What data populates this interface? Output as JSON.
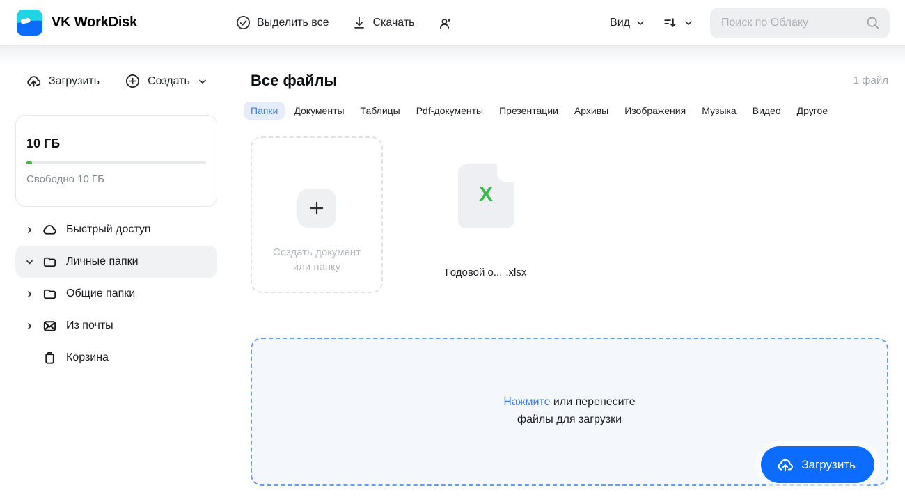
{
  "header": {
    "app_title": "VK WorkDisk",
    "actions": {
      "select_all": "Выделить все",
      "download": "Скачать"
    },
    "view": {
      "label": "Вид"
    },
    "search": {
      "placeholder": "Поиск по Облаку"
    }
  },
  "sidebar": {
    "upload_label": "Загрузить",
    "create_label": "Создать",
    "storage": {
      "total": "10 ГБ",
      "free_label": "Свободно 10 ГБ",
      "used_percent": 2
    },
    "items": [
      {
        "label": "Быстрый доступ",
        "icon": "cloud-icon",
        "chevron": "right",
        "selected": false
      },
      {
        "label": "Личные папки",
        "icon": "folder-icon",
        "chevron": "down",
        "selected": true
      },
      {
        "label": "Общие папки",
        "icon": "folder-icon",
        "chevron": "right",
        "selected": false
      },
      {
        "label": "Из почты",
        "icon": "mail-icon",
        "chevron": "right",
        "selected": false
      },
      {
        "label": "Корзина",
        "icon": "trash-icon",
        "chevron": "none",
        "selected": false
      }
    ]
  },
  "main": {
    "title": "Все файлы",
    "files_count": "1 файл",
    "tabs": [
      {
        "label": "Папки",
        "selected": true
      },
      {
        "label": "Документы",
        "selected": false
      },
      {
        "label": "Таблицы",
        "selected": false
      },
      {
        "label": "Pdf-документы",
        "selected": false
      },
      {
        "label": "Презентации",
        "selected": false
      },
      {
        "label": "Архивы",
        "selected": false
      },
      {
        "label": "Изображения",
        "selected": false
      },
      {
        "label": "Музыка",
        "selected": false
      },
      {
        "label": "Видео",
        "selected": false
      },
      {
        "label": "Другое",
        "selected": false
      }
    ],
    "create_tile": {
      "line1": "Создать документ",
      "line2": "или папку"
    },
    "file_tile": {
      "name": "Годовой о...",
      "extension": ".xlsx",
      "type_letter": "X",
      "type_color": "#3cb94c"
    },
    "dropzone": {
      "click_word": "Нажмите",
      "line1_rest": "или перенесите",
      "line2": "файлы для загрузки",
      "upload_button": "Загрузить"
    }
  },
  "colors": {
    "accent_blue": "#0b6cff",
    "brand_cyan": "#1fd4e4",
    "progress_green": "#4bb34b",
    "tab_selected_bg": "#e4ecfd",
    "tab_selected_text": "#3c82ef",
    "dropzone_border": "#6a9bef",
    "dropzone_bg": "#f4f7fb"
  }
}
